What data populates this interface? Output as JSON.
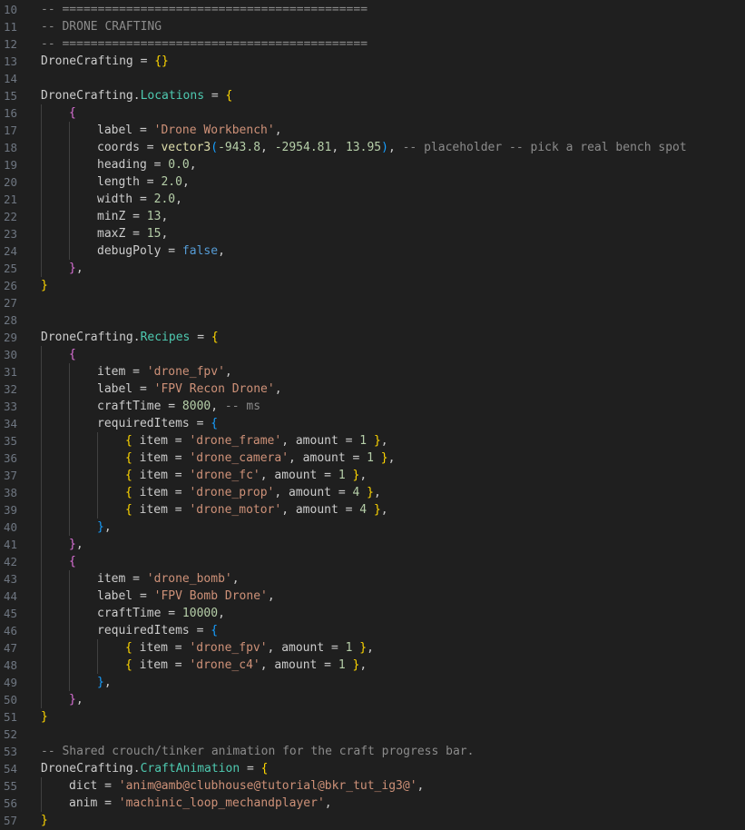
{
  "editor": {
    "language": "lua",
    "colors": {
      "background": "#1f1f1f",
      "line_number": "#6e7681",
      "comment": "#8b8b8b",
      "string": "#ce9178",
      "number": "#b5cea8",
      "property": "#4ec9b0",
      "function": "#dcdcaa",
      "keyword": "#569cd6",
      "bracket_1": "#ffd700",
      "bracket_2": "#da70d6",
      "bracket_3": "#179fff"
    },
    "lines": [
      {
        "n": "10",
        "indent": 0,
        "tokens": [
          [
            "cg",
            "-- ==========================================="
          ]
        ]
      },
      {
        "n": "11",
        "indent": 0,
        "tokens": [
          [
            "cg",
            "-- DRONE CRAFTING"
          ]
        ]
      },
      {
        "n": "12",
        "indent": 0,
        "tokens": [
          [
            "cg",
            "-- ==========================================="
          ]
        ]
      },
      {
        "n": "13",
        "indent": 0,
        "tokens": [
          [
            "id",
            "DroneCrafting = "
          ],
          [
            "b1",
            "{}"
          ]
        ]
      },
      {
        "n": "14",
        "indent": 0,
        "tokens": []
      },
      {
        "n": "15",
        "indent": 0,
        "tokens": [
          [
            "id",
            "DroneCrafting."
          ],
          [
            "prop",
            "Locations"
          ],
          [
            "id",
            " = "
          ],
          [
            "b1",
            "{"
          ]
        ]
      },
      {
        "n": "16",
        "indent": 1,
        "tokens": [
          [
            "b2",
            "{"
          ]
        ]
      },
      {
        "n": "17",
        "indent": 2,
        "tokens": [
          [
            "id",
            "label = "
          ],
          [
            "s",
            "'Drone Workbench'"
          ],
          [
            "id",
            ","
          ]
        ]
      },
      {
        "n": "18",
        "indent": 2,
        "tokens": [
          [
            "id",
            "coords = "
          ],
          [
            "fn",
            "vector3"
          ],
          [
            "b3",
            "("
          ],
          [
            "n",
            "-943.8"
          ],
          [
            "id",
            ", "
          ],
          [
            "n",
            "-2954.81"
          ],
          [
            "id",
            ", "
          ],
          [
            "n",
            "13.95"
          ],
          [
            "b3",
            ")"
          ],
          [
            "id",
            ", "
          ],
          [
            "cg",
            "-- placeholder -- pick a real bench spot"
          ]
        ]
      },
      {
        "n": "19",
        "indent": 2,
        "tokens": [
          [
            "id",
            "heading = "
          ],
          [
            "n",
            "0.0"
          ],
          [
            "id",
            ","
          ]
        ]
      },
      {
        "n": "20",
        "indent": 2,
        "tokens": [
          [
            "id",
            "length = "
          ],
          [
            "n",
            "2.0"
          ],
          [
            "id",
            ","
          ]
        ]
      },
      {
        "n": "21",
        "indent": 2,
        "tokens": [
          [
            "id",
            "width = "
          ],
          [
            "n",
            "2.0"
          ],
          [
            "id",
            ","
          ]
        ]
      },
      {
        "n": "22",
        "indent": 2,
        "tokens": [
          [
            "id",
            "minZ = "
          ],
          [
            "n",
            "13"
          ],
          [
            "id",
            ","
          ]
        ]
      },
      {
        "n": "23",
        "indent": 2,
        "tokens": [
          [
            "id",
            "maxZ = "
          ],
          [
            "n",
            "15"
          ],
          [
            "id",
            ","
          ]
        ]
      },
      {
        "n": "24",
        "indent": 2,
        "tokens": [
          [
            "id",
            "debugPoly = "
          ],
          [
            "kw",
            "false"
          ],
          [
            "id",
            ","
          ]
        ]
      },
      {
        "n": "25",
        "indent": 1,
        "tokens": [
          [
            "b2",
            "}"
          ],
          [
            "id",
            ","
          ]
        ]
      },
      {
        "n": "26",
        "indent": 0,
        "tokens": [
          [
            "b1",
            "}"
          ]
        ]
      },
      {
        "n": "27",
        "indent": 0,
        "tokens": []
      },
      {
        "n": "28",
        "indent": 0,
        "tokens": []
      },
      {
        "n": "29",
        "indent": 0,
        "tokens": [
          [
            "id",
            "DroneCrafting."
          ],
          [
            "prop",
            "Recipes"
          ],
          [
            "id",
            " = "
          ],
          [
            "b1",
            "{"
          ]
        ]
      },
      {
        "n": "30",
        "indent": 1,
        "tokens": [
          [
            "b2",
            "{"
          ]
        ]
      },
      {
        "n": "31",
        "indent": 2,
        "tokens": [
          [
            "id",
            "item = "
          ],
          [
            "s",
            "'drone_fpv'"
          ],
          [
            "id",
            ","
          ]
        ]
      },
      {
        "n": "32",
        "indent": 2,
        "tokens": [
          [
            "id",
            "label = "
          ],
          [
            "s",
            "'FPV Recon Drone'"
          ],
          [
            "id",
            ","
          ]
        ]
      },
      {
        "n": "33",
        "indent": 2,
        "tokens": [
          [
            "id",
            "craftTime = "
          ],
          [
            "n",
            "8000"
          ],
          [
            "id",
            ", "
          ],
          [
            "cg",
            "-- ms"
          ]
        ]
      },
      {
        "n": "34",
        "indent": 2,
        "tokens": [
          [
            "id",
            "requiredItems = "
          ],
          [
            "b3",
            "{"
          ]
        ]
      },
      {
        "n": "35",
        "indent": 3,
        "tokens": [
          [
            "b1",
            "{"
          ],
          [
            "id",
            " item = "
          ],
          [
            "s",
            "'drone_frame'"
          ],
          [
            "id",
            ", amount = "
          ],
          [
            "n",
            "1"
          ],
          [
            "id",
            " "
          ],
          [
            "b1",
            "}"
          ],
          [
            "id",
            ","
          ]
        ]
      },
      {
        "n": "36",
        "indent": 3,
        "tokens": [
          [
            "b1",
            "{"
          ],
          [
            "id",
            " item = "
          ],
          [
            "s",
            "'drone_camera'"
          ],
          [
            "id",
            ", amount = "
          ],
          [
            "n",
            "1"
          ],
          [
            "id",
            " "
          ],
          [
            "b1",
            "}"
          ],
          [
            "id",
            ","
          ]
        ]
      },
      {
        "n": "37",
        "indent": 3,
        "tokens": [
          [
            "b1",
            "{"
          ],
          [
            "id",
            " item = "
          ],
          [
            "s",
            "'drone_fc'"
          ],
          [
            "id",
            ", amount = "
          ],
          [
            "n",
            "1"
          ],
          [
            "id",
            " "
          ],
          [
            "b1",
            "}"
          ],
          [
            "id",
            ","
          ]
        ]
      },
      {
        "n": "38",
        "indent": 3,
        "tokens": [
          [
            "b1",
            "{"
          ],
          [
            "id",
            " item = "
          ],
          [
            "s",
            "'drone_prop'"
          ],
          [
            "id",
            ", amount = "
          ],
          [
            "n",
            "4"
          ],
          [
            "id",
            " "
          ],
          [
            "b1",
            "}"
          ],
          [
            "id",
            ","
          ]
        ]
      },
      {
        "n": "39",
        "indent": 3,
        "tokens": [
          [
            "b1",
            "{"
          ],
          [
            "id",
            " item = "
          ],
          [
            "s",
            "'drone_motor'"
          ],
          [
            "id",
            ", amount = "
          ],
          [
            "n",
            "4"
          ],
          [
            "id",
            " "
          ],
          [
            "b1",
            "}"
          ],
          [
            "id",
            ","
          ]
        ]
      },
      {
        "n": "40",
        "indent": 2,
        "tokens": [
          [
            "b3",
            "}"
          ],
          [
            "id",
            ","
          ]
        ]
      },
      {
        "n": "41",
        "indent": 1,
        "tokens": [
          [
            "b2",
            "}"
          ],
          [
            "id",
            ","
          ]
        ]
      },
      {
        "n": "42",
        "indent": 1,
        "tokens": [
          [
            "b2",
            "{"
          ]
        ]
      },
      {
        "n": "43",
        "indent": 2,
        "tokens": [
          [
            "id",
            "item = "
          ],
          [
            "s",
            "'drone_bomb'"
          ],
          [
            "id",
            ","
          ]
        ]
      },
      {
        "n": "44",
        "indent": 2,
        "tokens": [
          [
            "id",
            "label = "
          ],
          [
            "s",
            "'FPV Bomb Drone'"
          ],
          [
            "id",
            ","
          ]
        ]
      },
      {
        "n": "45",
        "indent": 2,
        "tokens": [
          [
            "id",
            "craftTime = "
          ],
          [
            "n",
            "10000"
          ],
          [
            "id",
            ","
          ]
        ]
      },
      {
        "n": "46",
        "indent": 2,
        "tokens": [
          [
            "id",
            "requiredItems = "
          ],
          [
            "b3",
            "{"
          ]
        ]
      },
      {
        "n": "47",
        "indent": 3,
        "tokens": [
          [
            "b1",
            "{"
          ],
          [
            "id",
            " item = "
          ],
          [
            "s",
            "'drone_fpv'"
          ],
          [
            "id",
            ", amount = "
          ],
          [
            "n",
            "1"
          ],
          [
            "id",
            " "
          ],
          [
            "b1",
            "}"
          ],
          [
            "id",
            ","
          ]
        ]
      },
      {
        "n": "48",
        "indent": 3,
        "tokens": [
          [
            "b1",
            "{"
          ],
          [
            "id",
            " item = "
          ],
          [
            "s",
            "'drone_c4'"
          ],
          [
            "id",
            ", amount = "
          ],
          [
            "n",
            "1"
          ],
          [
            "id",
            " "
          ],
          [
            "b1",
            "}"
          ],
          [
            "id",
            ","
          ]
        ]
      },
      {
        "n": "49",
        "indent": 2,
        "tokens": [
          [
            "b3",
            "}"
          ],
          [
            "id",
            ","
          ]
        ]
      },
      {
        "n": "50",
        "indent": 1,
        "tokens": [
          [
            "b2",
            "}"
          ],
          [
            "id",
            ","
          ]
        ]
      },
      {
        "n": "51",
        "indent": 0,
        "tokens": [
          [
            "b1",
            "}"
          ]
        ]
      },
      {
        "n": "52",
        "indent": 0,
        "tokens": []
      },
      {
        "n": "53",
        "indent": 0,
        "tokens": [
          [
            "cg",
            "-- Shared crouch/tinker animation for the craft progress bar."
          ]
        ]
      },
      {
        "n": "54",
        "indent": 0,
        "tokens": [
          [
            "id",
            "DroneCrafting."
          ],
          [
            "prop",
            "CraftAnimation"
          ],
          [
            "id",
            " = "
          ],
          [
            "b1",
            "{"
          ]
        ]
      },
      {
        "n": "55",
        "indent": 1,
        "tokens": [
          [
            "id",
            "dict = "
          ],
          [
            "s",
            "'anim@amb@clubhouse@tutorial@bkr_tut_ig3@'"
          ],
          [
            "id",
            ","
          ]
        ]
      },
      {
        "n": "56",
        "indent": 1,
        "tokens": [
          [
            "id",
            "anim = "
          ],
          [
            "s",
            "'machinic_loop_mechandplayer'"
          ],
          [
            "id",
            ","
          ]
        ]
      },
      {
        "n": "57",
        "indent": 0,
        "tokens": [
          [
            "b1",
            "}"
          ]
        ]
      }
    ]
  }
}
